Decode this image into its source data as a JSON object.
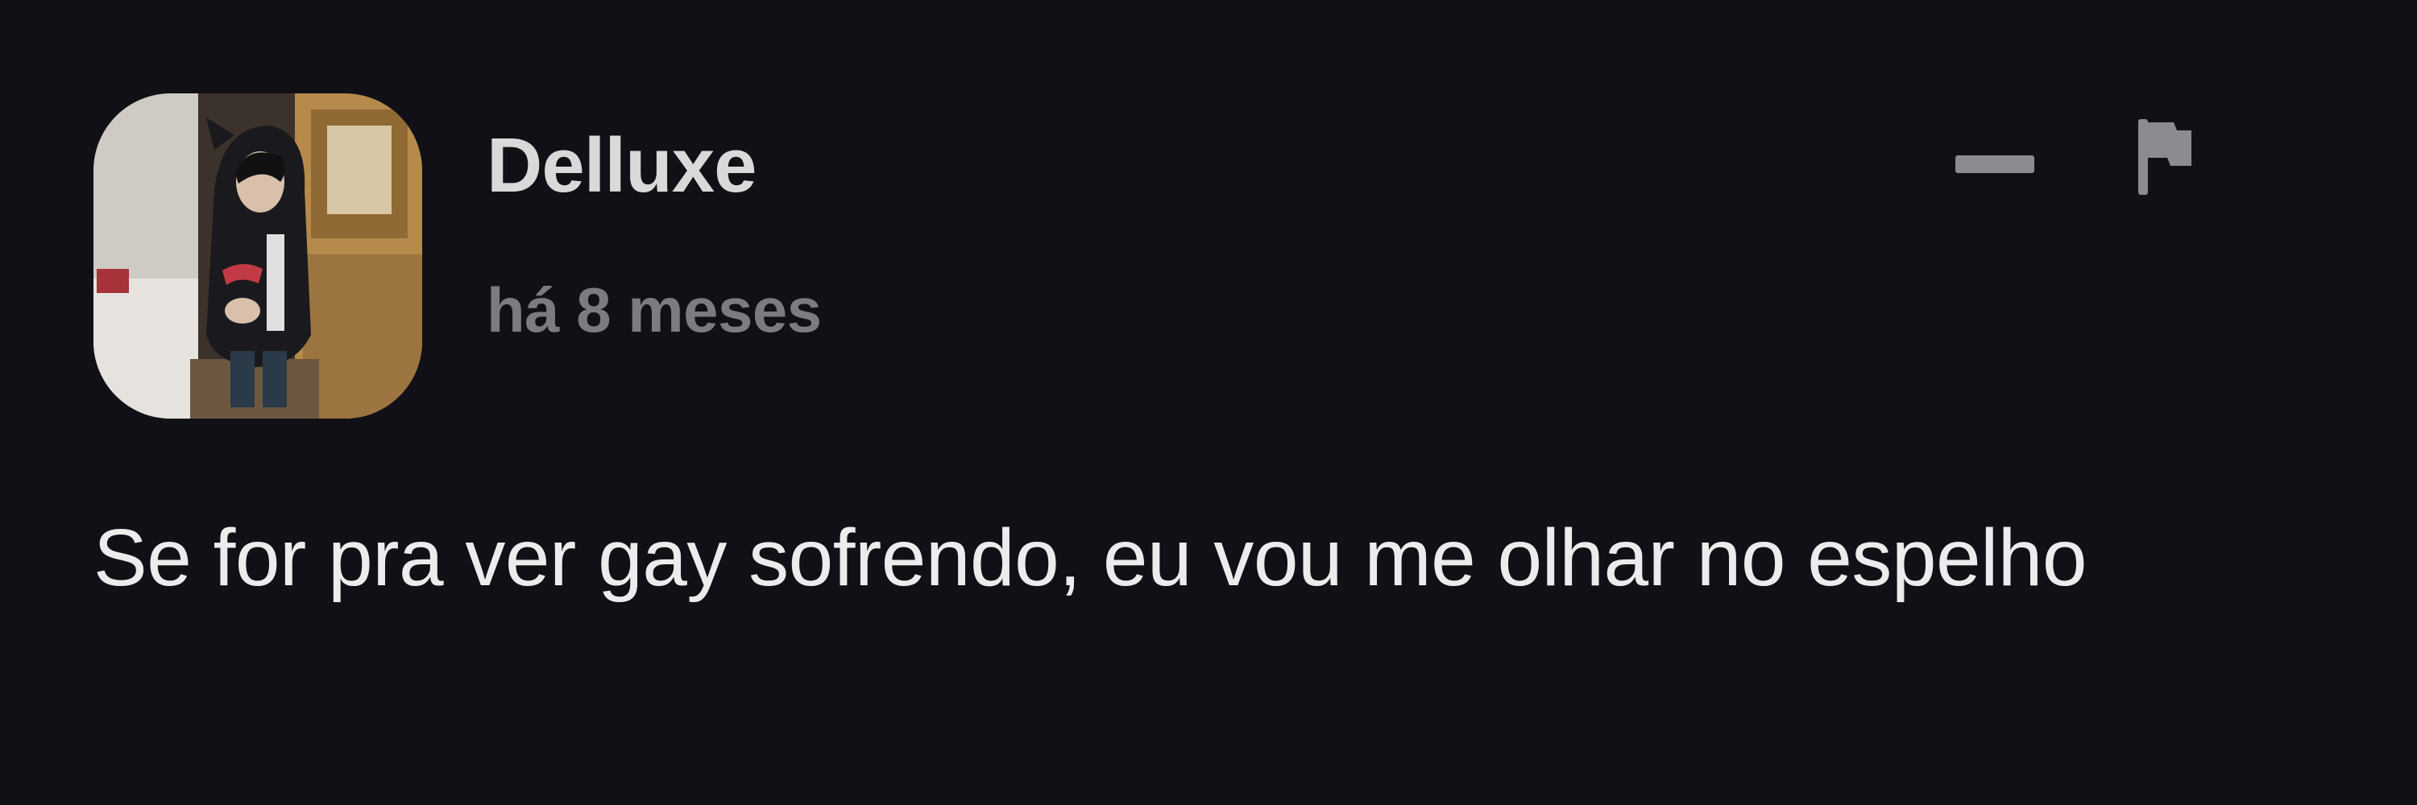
{
  "comment": {
    "author": "Delluxe",
    "timestamp": "há 8 meses",
    "text": "Se for pra ver gay sofrendo, eu vou me olhar no espelho",
    "avatar_icon": "user-photo-avatar",
    "actions": {
      "collapse_icon": "minus-icon",
      "report_icon": "flag-icon"
    }
  },
  "colors": {
    "background": "#111016",
    "author": "#d9d9d9",
    "timestamp": "#7c7c80",
    "text": "#ececec",
    "icons": "#8c8c90"
  }
}
